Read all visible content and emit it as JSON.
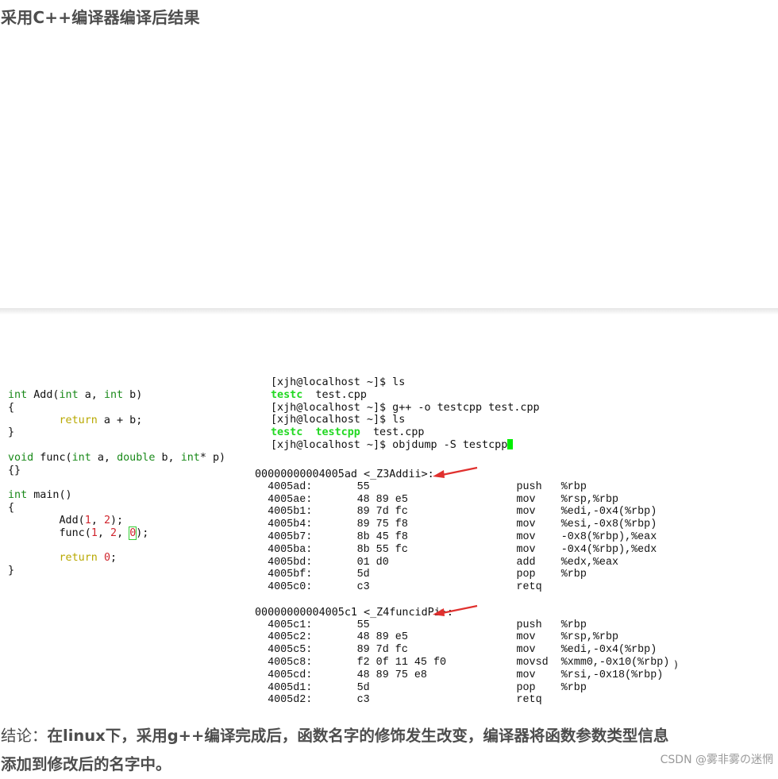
{
  "heading": "采用C++编译器编译后结果",
  "source_code": [
    [
      {
        "t": "int",
        "c": "kw-g"
      },
      {
        "t": " Add("
      },
      {
        "t": "int",
        "c": "kw-g"
      },
      {
        "t": " a, "
      },
      {
        "t": "int",
        "c": "kw-g"
      },
      {
        "t": " b)"
      }
    ],
    [
      {
        "t": "{"
      }
    ],
    [
      {
        "t": "        "
      },
      {
        "t": "return",
        "c": "kw-y"
      },
      {
        "t": " a + b;"
      }
    ],
    [
      {
        "t": "}"
      }
    ],
    [],
    [
      {
        "t": "void",
        "c": "kw-g"
      },
      {
        "t": " func("
      },
      {
        "t": "int",
        "c": "kw-g"
      },
      {
        "t": " a, "
      },
      {
        "t": "double",
        "c": "kw-g"
      },
      {
        "t": " b, "
      },
      {
        "t": "int",
        "c": "kw-g"
      },
      {
        "t": "* p)"
      }
    ],
    [
      {
        "t": "{}"
      }
    ],
    [],
    [
      {
        "t": "int",
        "c": "kw-g"
      },
      {
        "t": " main()"
      }
    ],
    [
      {
        "t": "{"
      }
    ],
    [
      {
        "t": "        Add("
      },
      {
        "t": "1",
        "c": "num"
      },
      {
        "t": ", "
      },
      {
        "t": "2",
        "c": "num"
      },
      {
        "t": ");"
      }
    ],
    [
      {
        "t": "        func("
      },
      {
        "t": "1",
        "c": "num"
      },
      {
        "t": ", "
      },
      {
        "t": "2",
        "c": "num"
      },
      {
        "t": ", "
      },
      {
        "t": "0",
        "c": "num cursor-box"
      },
      {
        "t": ");"
      }
    ],
    [],
    [
      {
        "t": "        "
      },
      {
        "t": "return",
        "c": "kw-y"
      },
      {
        "t": " "
      },
      {
        "t": "0",
        "c": "num"
      },
      {
        "t": ";"
      }
    ],
    [
      {
        "t": "}"
      }
    ]
  ],
  "terminal": [
    [
      {
        "t": "[xjh@localhost ~]$ ls"
      }
    ],
    [
      {
        "t": "testc",
        "c": "green"
      },
      {
        "t": "  test.cpp"
      }
    ],
    [
      {
        "t": "[xjh@localhost ~]$ g++ -o testcpp test.cpp"
      }
    ],
    [
      {
        "t": "[xjh@localhost ~]$ ls"
      }
    ],
    [
      {
        "t": "testc",
        "c": "green"
      },
      {
        "t": "  "
      },
      {
        "t": "testcpp",
        "c": "green"
      },
      {
        "t": "  test.cpp"
      }
    ],
    [
      {
        "t": "[xjh@localhost ~]$ objdump -S testcpp"
      },
      {
        "cursor": true
      }
    ]
  ],
  "disasm_blocks": [
    {
      "symbol": "00000000004005ad <_Z3Addii>:",
      "rows": [
        {
          "addr": "4005ad:",
          "bytes": "55",
          "op": "push",
          "args": "%rbp"
        },
        {
          "addr": "4005ae:",
          "bytes": "48 89 e5",
          "op": "mov",
          "args": "%rsp,%rbp"
        },
        {
          "addr": "4005b1:",
          "bytes": "89 7d fc",
          "op": "mov",
          "args": "%edi,-0x4(%rbp)"
        },
        {
          "addr": "4005b4:",
          "bytes": "89 75 f8",
          "op": "mov",
          "args": "%esi,-0x8(%rbp)"
        },
        {
          "addr": "4005b7:",
          "bytes": "8b 45 f8",
          "op": "mov",
          "args": "-0x8(%rbp),%eax"
        },
        {
          "addr": "4005ba:",
          "bytes": "8b 55 fc",
          "op": "mov",
          "args": "-0x4(%rbp),%edx"
        },
        {
          "addr": "4005bd:",
          "bytes": "01 d0",
          "op": "add",
          "args": "%edx,%eax"
        },
        {
          "addr": "4005bf:",
          "bytes": "5d",
          "op": "pop",
          "args": "%rbp"
        },
        {
          "addr": "4005c0:",
          "bytes": "c3",
          "op": "retq",
          "args": ""
        }
      ]
    },
    {
      "symbol": "00000000004005c1 <_Z4funcidPi>:",
      "rows": [
        {
          "addr": "4005c1:",
          "bytes": "55",
          "op": "push",
          "args": "%rbp"
        },
        {
          "addr": "4005c2:",
          "bytes": "48 89 e5",
          "op": "mov",
          "args": "%rsp,%rbp"
        },
        {
          "addr": "4005c5:",
          "bytes": "89 7d fc",
          "op": "mov",
          "args": "%edi,-0x4(%rbp)"
        },
        {
          "addr": "4005c8:",
          "bytes": "f2 0f 11 45 f0",
          "op": "movsd",
          "args": "%xmm0,-0x10(%rbp)"
        },
        {
          "addr": "4005cd:",
          "bytes": "48 89 75 e8",
          "op": "mov",
          "args": "%rsi,-0x18(%rbp)"
        },
        {
          "addr": "4005d1:",
          "bytes": "5d",
          "op": "pop",
          "args": "%rbp"
        },
        {
          "addr": "4005d2:",
          "bytes": "c3",
          "op": "retq",
          "args": ""
        }
      ]
    }
  ],
  "stray_paren": ")",
  "conclusion": {
    "prefix": "结论：",
    "body": "在linux下，采用g++编译完成后，函数名字的修饰发生改变，编译器将函数参数类型信息添加到修改后的名字中。"
  },
  "watermark": "CSDN @雾非雾の迷惘",
  "colors": {
    "arrow": "#e0302e",
    "keyword_green": "#1a8a1a",
    "keyword_yellow": "#b8a800",
    "number_red": "#d0262e",
    "terminal_green": "#22d822"
  }
}
